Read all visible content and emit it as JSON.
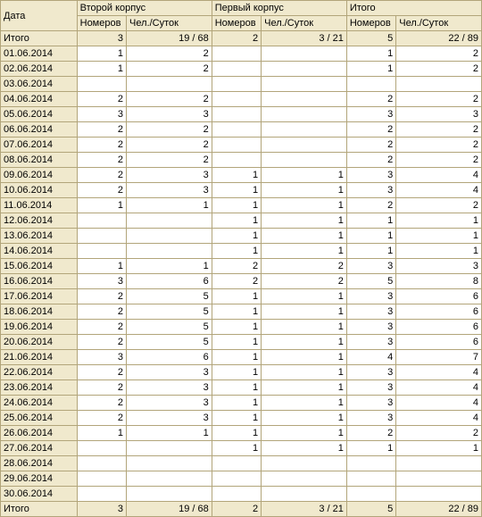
{
  "headers": {
    "date": "Дата",
    "group1": "Второй корпус",
    "group2": "Первый корпус",
    "group3": "Итого",
    "sub_rooms": "Номеров",
    "sub_persons": "Чел./Суток"
  },
  "tot_label": "Итого",
  "top_totals": {
    "g1_rooms": "3",
    "g1_pers": "19 / 68",
    "g2_rooms": "2",
    "g2_pers": "3 / 21",
    "g3_rooms": "5",
    "g3_pers": "22 / 89"
  },
  "rows": [
    {
      "date": "01.06.2014",
      "g1r": "1",
      "g1p": "2",
      "g2r": "",
      "g2p": "",
      "g3r": "1",
      "g3p": "2"
    },
    {
      "date": "02.06.2014",
      "g1r": "1",
      "g1p": "2",
      "g2r": "",
      "g2p": "",
      "g3r": "1",
      "g3p": "2"
    },
    {
      "date": "03.06.2014",
      "g1r": "",
      "g1p": "",
      "g2r": "",
      "g2p": "",
      "g3r": "",
      "g3p": ""
    },
    {
      "date": "04.06.2014",
      "g1r": "2",
      "g1p": "2",
      "g2r": "",
      "g2p": "",
      "g3r": "2",
      "g3p": "2"
    },
    {
      "date": "05.06.2014",
      "g1r": "3",
      "g1p": "3",
      "g2r": "",
      "g2p": "",
      "g3r": "3",
      "g3p": "3"
    },
    {
      "date": "06.06.2014",
      "g1r": "2",
      "g1p": "2",
      "g2r": "",
      "g2p": "",
      "g3r": "2",
      "g3p": "2"
    },
    {
      "date": "07.06.2014",
      "g1r": "2",
      "g1p": "2",
      "g2r": "",
      "g2p": "",
      "g3r": "2",
      "g3p": "2"
    },
    {
      "date": "08.06.2014",
      "g1r": "2",
      "g1p": "2",
      "g2r": "",
      "g2p": "",
      "g3r": "2",
      "g3p": "2"
    },
    {
      "date": "09.06.2014",
      "g1r": "2",
      "g1p": "3",
      "g2r": "1",
      "g2p": "1",
      "g3r": "3",
      "g3p": "4"
    },
    {
      "date": "10.06.2014",
      "g1r": "2",
      "g1p": "3",
      "g2r": "1",
      "g2p": "1",
      "g3r": "3",
      "g3p": "4"
    },
    {
      "date": "11.06.2014",
      "g1r": "1",
      "g1p": "1",
      "g2r": "1",
      "g2p": "1",
      "g3r": "2",
      "g3p": "2"
    },
    {
      "date": "12.06.2014",
      "g1r": "",
      "g1p": "",
      "g2r": "1",
      "g2p": "1",
      "g3r": "1",
      "g3p": "1"
    },
    {
      "date": "13.06.2014",
      "g1r": "",
      "g1p": "",
      "g2r": "1",
      "g2p": "1",
      "g3r": "1",
      "g3p": "1"
    },
    {
      "date": "14.06.2014",
      "g1r": "",
      "g1p": "",
      "g2r": "1",
      "g2p": "1",
      "g3r": "1",
      "g3p": "1"
    },
    {
      "date": "15.06.2014",
      "g1r": "1",
      "g1p": "1",
      "g2r": "2",
      "g2p": "2",
      "g3r": "3",
      "g3p": "3"
    },
    {
      "date": "16.06.2014",
      "g1r": "3",
      "g1p": "6",
      "g2r": "2",
      "g2p": "2",
      "g3r": "5",
      "g3p": "8"
    },
    {
      "date": "17.06.2014",
      "g1r": "2",
      "g1p": "5",
      "g2r": "1",
      "g2p": "1",
      "g3r": "3",
      "g3p": "6"
    },
    {
      "date": "18.06.2014",
      "g1r": "2",
      "g1p": "5",
      "g2r": "1",
      "g2p": "1",
      "g3r": "3",
      "g3p": "6"
    },
    {
      "date": "19.06.2014",
      "g1r": "2",
      "g1p": "5",
      "g2r": "1",
      "g2p": "1",
      "g3r": "3",
      "g3p": "6"
    },
    {
      "date": "20.06.2014",
      "g1r": "2",
      "g1p": "5",
      "g2r": "1",
      "g2p": "1",
      "g3r": "3",
      "g3p": "6"
    },
    {
      "date": "21.06.2014",
      "g1r": "3",
      "g1p": "6",
      "g2r": "1",
      "g2p": "1",
      "g3r": "4",
      "g3p": "7"
    },
    {
      "date": "22.06.2014",
      "g1r": "2",
      "g1p": "3",
      "g2r": "1",
      "g2p": "1",
      "g3r": "3",
      "g3p": "4"
    },
    {
      "date": "23.06.2014",
      "g1r": "2",
      "g1p": "3",
      "g2r": "1",
      "g2p": "1",
      "g3r": "3",
      "g3p": "4"
    },
    {
      "date": "24.06.2014",
      "g1r": "2",
      "g1p": "3",
      "g2r": "1",
      "g2p": "1",
      "g3r": "3",
      "g3p": "4"
    },
    {
      "date": "25.06.2014",
      "g1r": "2",
      "g1p": "3",
      "g2r": "1",
      "g2p": "1",
      "g3r": "3",
      "g3p": "4"
    },
    {
      "date": "26.06.2014",
      "g1r": "1",
      "g1p": "1",
      "g2r": "1",
      "g2p": "1",
      "g3r": "2",
      "g3p": "2"
    },
    {
      "date": "27.06.2014",
      "g1r": "",
      "g1p": "",
      "g2r": "1",
      "g2p": "1",
      "g3r": "1",
      "g3p": "1"
    },
    {
      "date": "28.06.2014",
      "g1r": "",
      "g1p": "",
      "g2r": "",
      "g2p": "",
      "g3r": "",
      "g3p": ""
    },
    {
      "date": "29.06.2014",
      "g1r": "",
      "g1p": "",
      "g2r": "",
      "g2p": "",
      "g3r": "",
      "g3p": ""
    },
    {
      "date": "30.06.2014",
      "g1r": "",
      "g1p": "",
      "g2r": "",
      "g2p": "",
      "g3r": "",
      "g3p": ""
    }
  ],
  "bottom_totals": {
    "g1_rooms": "3",
    "g1_pers": "19 / 68",
    "g2_rooms": "2",
    "g2_pers": "3 / 21",
    "g3_rooms": "5",
    "g3_pers": "22 / 89"
  }
}
